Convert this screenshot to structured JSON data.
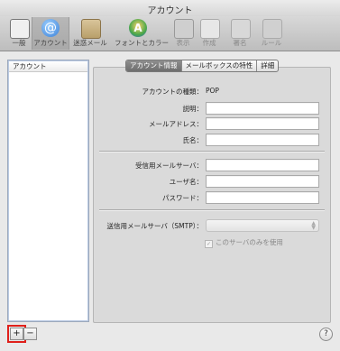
{
  "window": {
    "title": "アカウント"
  },
  "toolbar": {
    "items": [
      {
        "id": "general",
        "label": "一般"
      },
      {
        "id": "accounts",
        "label": "アカウント"
      },
      {
        "id": "junk",
        "label": "迷惑メール"
      },
      {
        "id": "fonts",
        "label": "フォントとカラー"
      },
      {
        "id": "view",
        "label": "表示"
      },
      {
        "id": "compose",
        "label": "作成"
      },
      {
        "id": "signature",
        "label": "署名"
      },
      {
        "id": "rules",
        "label": "ルール"
      }
    ],
    "selected": "accounts"
  },
  "account_list": {
    "header": "アカウント"
  },
  "buttons": {
    "add": "+",
    "remove": "−",
    "help": "?"
  },
  "tabs": [
    {
      "label": "アカウント情報",
      "selected": true
    },
    {
      "label": "メールボックスの特性",
      "selected": false
    },
    {
      "label": "詳細",
      "selected": false
    }
  ],
  "form": {
    "account_type_label": "アカウントの種類：",
    "account_type_value": "POP",
    "description_label": "説明：",
    "email_label": "メールアドレス：",
    "fullname_label": "氏名：",
    "incoming_label": "受信用メールサーバ：",
    "username_label": "ユーザ名：",
    "password_label": "パスワード：",
    "outgoing_label": "送信用メールサーバ（SMTP）：",
    "only_this_server": "このサーバのみを使用"
  }
}
